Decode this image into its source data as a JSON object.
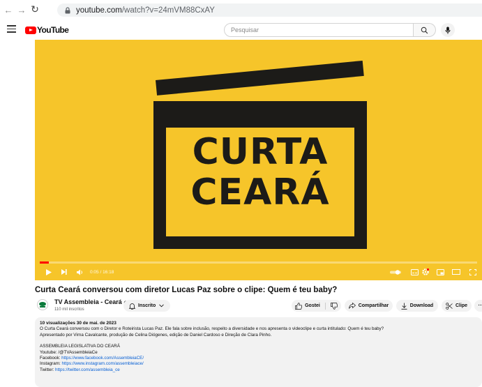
{
  "browser": {
    "url_host": "youtube.com",
    "url_path": "/watch?v=24mVM88CxAY"
  },
  "header": {
    "logo_text": "YouTube",
    "search_placeholder": "Pesquisar"
  },
  "video": {
    "thumbnail_line1": "CURTA",
    "thumbnail_line2": "CEARÁ",
    "time": "0:05 / 16:18",
    "progress": 0.005,
    "accent": "#ff0000",
    "title": "Curta Ceará conversou com diretor Lucas Paz sobre o clipe: Quem é teu baby?"
  },
  "channel": {
    "name": "TV Assembleia - Ceará",
    "verified_mark": "⊕",
    "subscribers": "110 mil inscritos",
    "subscribe_label": "Inscrito"
  },
  "actions": {
    "like_label": "Gostei",
    "share_label": "Compartilhar",
    "download_label": "Download",
    "clip_label": "Clipe",
    "more_label": "···"
  },
  "description": {
    "meta": "10 visualizações  30 de mai. de 2023",
    "line1": "O Curta Ceará conversou com o Diretor e Roteirista Lucas Paz. Ele fala sobre inclusão, respeito a diversidade e nos apresenta o videoclipe e curta intitulado: Quem é teu baby?",
    "line2": "Apresentado por Virna Cavalcante, produção de Celina Diógenes, edição de Daniel Cardoso e Direção de Clara Pinho.",
    "org": "ASSEMBLEIA LEGISLATIVA DO CEARÁ",
    "youtube_line": "Youtube: /@TVAssembleiaCe",
    "facebook_label": "Facebook: ",
    "facebook_url": "https://www.facebook.com/AssembleiaCE/",
    "instagram_label": "Instagram: ",
    "instagram_url": "https://www.instagram.com/assembleiace/",
    "twitter_label": "Twitter: ",
    "twitter_url": "https://twitter.com/assembleia_ce"
  }
}
